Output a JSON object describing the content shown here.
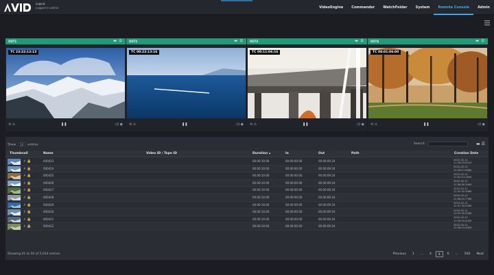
{
  "header": {
    "user_line1": "Logout",
    "user_line2": "Logged in admin",
    "nav": [
      "VideoEngine",
      "Commander",
      "WatchFolder",
      "System",
      "Remote Console",
      "Admin"
    ],
    "active_nav": "Remote Console"
  },
  "panels": [
    {
      "name": "OUT1",
      "tc": "TC 23:22:12:13",
      "scene": "mountain"
    },
    {
      "name": "OUT2",
      "tc": "TC 00:22:13:16",
      "scene": "sea"
    },
    {
      "name": "OUT3",
      "tc": "TC 00:11:06:16",
      "scene": "bridge"
    },
    {
      "name": "OUT4",
      "tc": "TC 00:01:06:00",
      "scene": "forest"
    }
  ],
  "panel_controls": {
    "header_icons": "▬ ☰",
    "left": "⟲ ⚠",
    "center": "❚❚",
    "right": "◁) ◉"
  },
  "table": {
    "show_label": "Show",
    "entries_value": "10",
    "entries_label": "entries",
    "search_label": "Search:",
    "columns": [
      "Thumbnail",
      "Name",
      "Video ID / Tape ID",
      "Duration",
      "In",
      "Out",
      "Path",
      "Creation Date"
    ],
    "rows": [
      {
        "name": "000423",
        "duration": "00:00:10:00",
        "in": "00:00:00:00",
        "out": "00:00:09:24",
        "date1": "2022-02-11",
        "date2": "11:26:23.8210"
      },
      {
        "name": "000424",
        "duration": "00:00:10:00",
        "in": "00:00:00:00",
        "out": "00:00:09:24",
        "date1": "2022-02-11",
        "date2": "11:28:17.6580"
      },
      {
        "name": "000425",
        "duration": "00:00:10:00",
        "in": "00:00:00:00",
        "out": "00:00:09:24",
        "date1": "2022-02-11",
        "date2": "11:42:11.2620"
      },
      {
        "name": "000426",
        "duration": "00:00:10:00",
        "in": "00:00:00:00",
        "out": "00:00:09:24",
        "date1": "2022-02-11",
        "date2": "11:38:50.3940"
      },
      {
        "name": "000427",
        "duration": "00:00:10:00",
        "in": "00:00:00:00",
        "out": "00:00:09:24",
        "date1": "2022-02-11",
        "date2": "11:32:32.4980"
      },
      {
        "name": "000428",
        "duration": "00:00:10:00",
        "in": "00:00:00:00",
        "out": "00:00:09:24",
        "date1": "2022-02-11",
        "date2": "11:36:41.7780"
      },
      {
        "name": "000429",
        "duration": "00:00:10:00",
        "in": "00:00:00:00",
        "out": "00:00:09:24",
        "date1": "2022-02-11",
        "date2": "11:47:34.4280"
      },
      {
        "name": "000430",
        "duration": "00:00:10:00",
        "in": "00:00:00:00",
        "out": "00:00:09:24",
        "date1": "2022-02-11",
        "date2": "11:52:32.4540"
      },
      {
        "name": "000431",
        "duration": "00:00:10:00",
        "in": "00:00:00:00",
        "out": "00:00:09:24",
        "date1": "2022-02-11",
        "date2": "11:28:33.4420"
      },
      {
        "name": "000432",
        "duration": "00:00:10:00",
        "in": "00:00:00:00",
        "out": "00:00:09:24",
        "date1": "2022-02-11",
        "date2": "11:28:19.4050"
      }
    ],
    "info": "Showing 41 to 50 of 5,014 entries",
    "pager": [
      "Previous",
      "1",
      "...",
      "4",
      "5",
      "6",
      "...",
      "502",
      "Next"
    ],
    "current_page": "5"
  }
}
